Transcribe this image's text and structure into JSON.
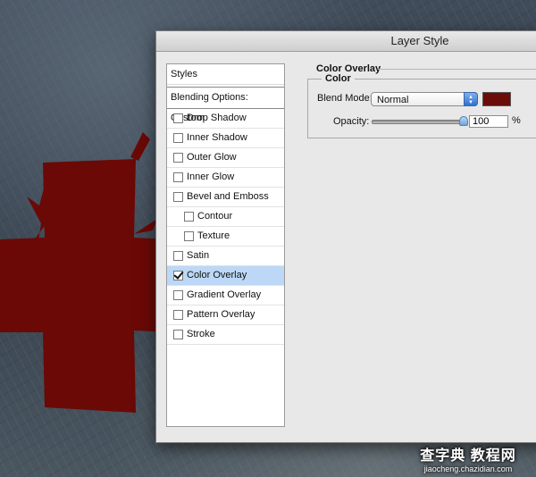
{
  "dialog": {
    "title": "Layer Style"
  },
  "styles_panel": {
    "header": "Styles",
    "blending_options": "Blending Options: Custom",
    "items": [
      {
        "label": "Drop Shadow",
        "checked": false,
        "indent": false,
        "selected": false
      },
      {
        "label": "Inner Shadow",
        "checked": false,
        "indent": false,
        "selected": false
      },
      {
        "label": "Outer Glow",
        "checked": false,
        "indent": false,
        "selected": false
      },
      {
        "label": "Inner Glow",
        "checked": false,
        "indent": false,
        "selected": false
      },
      {
        "label": "Bevel and Emboss",
        "checked": false,
        "indent": false,
        "selected": false
      },
      {
        "label": "Contour",
        "checked": false,
        "indent": true,
        "selected": false
      },
      {
        "label": "Texture",
        "checked": false,
        "indent": true,
        "selected": false
      },
      {
        "label": "Satin",
        "checked": false,
        "indent": false,
        "selected": false
      },
      {
        "label": "Color Overlay",
        "checked": true,
        "indent": false,
        "selected": true
      },
      {
        "label": "Gradient Overlay",
        "checked": false,
        "indent": false,
        "selected": false
      },
      {
        "label": "Pattern Overlay",
        "checked": false,
        "indent": false,
        "selected": false
      },
      {
        "label": "Stroke",
        "checked": false,
        "indent": false,
        "selected": false
      }
    ]
  },
  "color_overlay": {
    "section_title": "Color Overlay",
    "group_title": "Color",
    "blend_mode_label": "Blend Mode:",
    "blend_mode_value": "Normal",
    "swatch_color": "#6b0c08",
    "opacity_label": "Opacity:",
    "opacity_value": "100",
    "opacity_unit": "%",
    "opacity_fraction": 1.0
  },
  "canvas": {
    "cross_color": "#6b0906"
  },
  "watermark": {
    "main": "查字典 教程网",
    "url": "jiaocheng.chazidian.com"
  }
}
